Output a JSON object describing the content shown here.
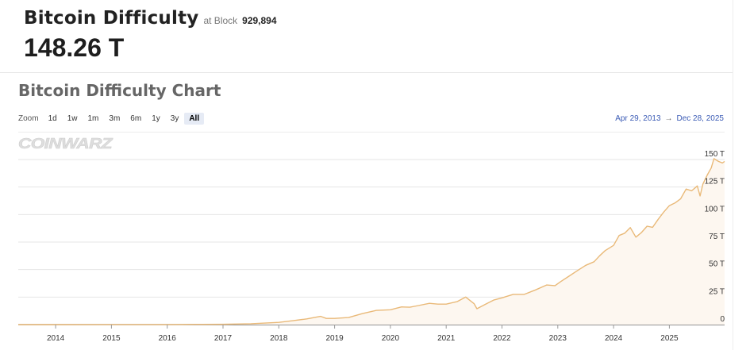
{
  "header": {
    "title": "Bitcoin Difficulty",
    "block_prefix": "at Block",
    "block_number": "929,894",
    "value": "148.26 T"
  },
  "chart_section": {
    "title": "Bitcoin Difficulty Chart",
    "zoom_label": "Zoom",
    "zoom_buttons": [
      "1d",
      "1w",
      "1m",
      "3m",
      "6m",
      "1y",
      "3y",
      "All"
    ],
    "zoom_active": "All",
    "range_start": "Apr 29, 2013",
    "range_arrow": "→",
    "range_end": "Dec 28, 2025",
    "watermark": "COINWARZ"
  },
  "colors": {
    "line": "#e9b978",
    "area_fill": "#fdf7f0",
    "grid": "#e6e6e6",
    "range_link": "#3b5bb5"
  },
  "chart_data": {
    "type": "area",
    "title": "Bitcoin Difficulty Chart",
    "xlabel": "",
    "ylabel": "",
    "unit": "T",
    "ylim": [
      0,
      150
    ],
    "y_ticks": [
      "0",
      "25 T",
      "50 T",
      "75 T",
      "100 T",
      "125 T",
      "150 T"
    ],
    "x_ticks": [
      "2014",
      "2015",
      "2016",
      "2017",
      "2018",
      "2019",
      "2020",
      "2021",
      "2022",
      "2023",
      "2024",
      "2025"
    ],
    "xlim": [
      2013.33,
      2025.99
    ],
    "grid": true,
    "legend": "none",
    "x": [
      2013.33,
      2014.0,
      2015.0,
      2016.0,
      2016.5,
      2017.0,
      2017.5,
      2018.0,
      2018.25,
      2018.5,
      2018.75,
      2018.85,
      2019.0,
      2019.25,
      2019.5,
      2019.75,
      2020.0,
      2020.2,
      2020.35,
      2020.5,
      2020.7,
      2020.85,
      2021.0,
      2021.2,
      2021.35,
      2021.5,
      2021.55,
      2021.7,
      2021.85,
      2022.0,
      2022.2,
      2022.4,
      2022.6,
      2022.8,
      2022.95,
      2023.05,
      2023.2,
      2023.35,
      2023.5,
      2023.65,
      2023.75,
      2023.85,
      2024.0,
      2024.1,
      2024.2,
      2024.3,
      2024.4,
      2024.5,
      2024.6,
      2024.7,
      2024.8,
      2024.9,
      2025.0,
      2025.1,
      2025.2,
      2025.3,
      2025.4,
      2025.5,
      2025.55,
      2025.6,
      2025.68,
      2025.75,
      2025.8,
      2025.88,
      2025.95,
      2025.99
    ],
    "y": [
      0.0,
      0.01,
      0.05,
      0.1,
      0.2,
      0.3,
      0.8,
      2.0,
      3.5,
      5.2,
      7.5,
      5.6,
      5.6,
      6.4,
      10.0,
      12.9,
      13.5,
      16.1,
      15.8,
      17.3,
      19.3,
      18.6,
      18.6,
      21.0,
      25.0,
      19.0,
      14.4,
      18.4,
      22.3,
      24.3,
      27.5,
      27.5,
      31.5,
      36.0,
      35.4,
      39.0,
      44.0,
      49.0,
      53.9,
      57.1,
      62.5,
      67.3,
      72.0,
      81.0,
      83.1,
      88.1,
      79.5,
      83.7,
      89.4,
      88.4,
      95.7,
      102.3,
      108.1,
      110.5,
      114.2,
      123.2,
      121.6,
      126.0,
      116.9,
      127.6,
      136.0,
      142.3,
      150.8,
      148.3,
      146.9,
      148.26
    ]
  }
}
